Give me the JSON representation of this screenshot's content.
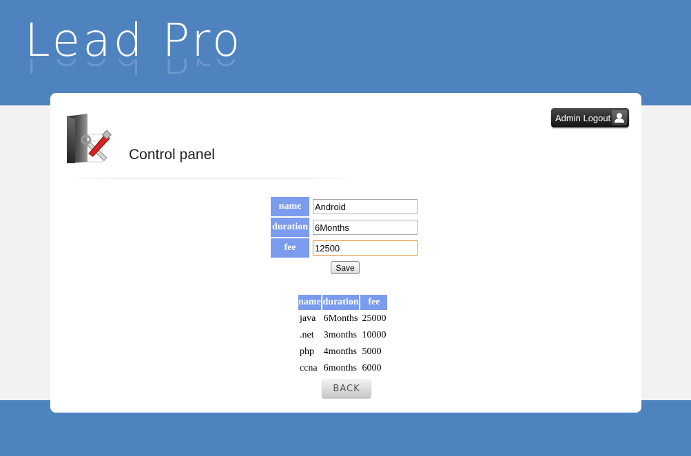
{
  "header": {
    "logo_text": "Lead Pro"
  },
  "panel": {
    "title": "Control panel",
    "logout_label": "Admin Logout"
  },
  "form": {
    "fields": [
      {
        "label": "name",
        "value": "Android"
      },
      {
        "label": "duration",
        "value": "6Months"
      },
      {
        "label": "fee",
        "value": "12500"
      }
    ],
    "save_label": "Save"
  },
  "table": {
    "columns": [
      "name",
      "duration",
      "fee"
    ],
    "rows": [
      [
        "java",
        "6Months",
        "25000"
      ],
      [
        ".net",
        "3months",
        "10000"
      ],
      [
        "php",
        "4months",
        "5000"
      ],
      [
        "ccna",
        "6months",
        "6000"
      ]
    ]
  },
  "back_label": "BACK",
  "colors": {
    "brand_blue": "#4f83bf",
    "label_blue": "#7b9bef",
    "page_background": "#f2f2f2"
  },
  "icons": {
    "panel_icon": "folder-tools-icon",
    "logout_icon": "user-icon"
  }
}
